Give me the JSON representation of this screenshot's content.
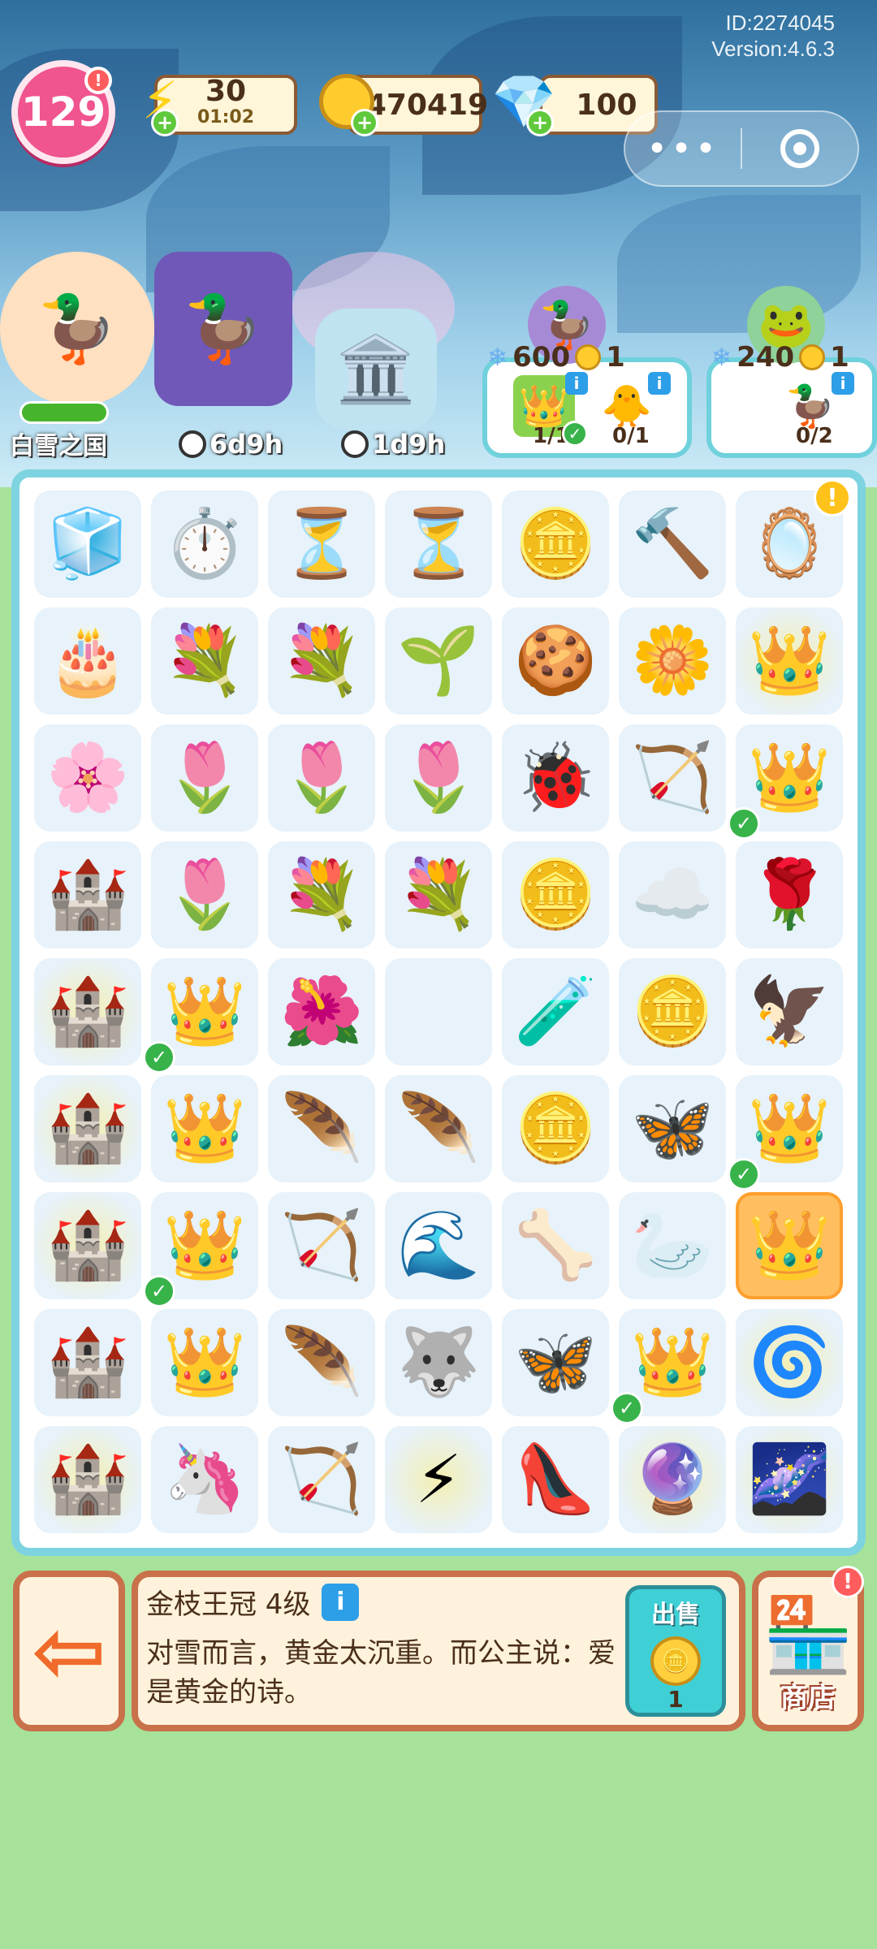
{
  "header": {
    "id": "ID:2274045",
    "version": "Version:4.6.3",
    "level": "129",
    "level_alert": "!",
    "energy": {
      "value": "30",
      "timer": "01:02",
      "icon": "lightning-icon"
    },
    "coins": {
      "value": "470419",
      "icon": "coin-icon"
    },
    "gems": {
      "value": "100",
      "icon": "gem-icon"
    },
    "plus": "+",
    "more_menu": "•••"
  },
  "events": {
    "kingdom_label": "白雪之国",
    "timer_1": "6d9h",
    "timer_2": "1d9h"
  },
  "orders": [
    {
      "reward_points": "600",
      "reward_coins": "1",
      "requirements": [
        {
          "count": "1/1",
          "done": true,
          "icon": "gold-crown-icon"
        },
        {
          "count": "0/1",
          "done": false,
          "icon": "duck-fairy-icon"
        }
      ]
    },
    {
      "reward_points": "240",
      "reward_coins": "1",
      "requirements": [
        {
          "count": "0/2",
          "done": false,
          "icon": "winged-duck-icon"
        }
      ]
    }
  ],
  "board": {
    "rows": [
      [
        "🧊",
        "⏱️",
        "⏳",
        "⏳",
        "🪙",
        "🔨",
        "🪞"
      ],
      [
        "🎂",
        "💐",
        "💐",
        "🌱",
        "🍪",
        "🌼",
        "👑"
      ],
      [
        "🌸",
        "🌷",
        "🌷",
        "🌷",
        "🐞",
        "🏹",
        "👑"
      ],
      [
        "🏰",
        "🌷",
        "💐",
        "💐",
        "🪙",
        "☁️",
        "🌹"
      ],
      [
        "🏰",
        "👑",
        "🌺",
        "",
        "🧪",
        "🪙",
        "🦅"
      ],
      [
        "🏰",
        "👑",
        "🪶",
        "🪶",
        "🪙",
        "🦋",
        "👑"
      ],
      [
        "🏰",
        "👑",
        "🏹",
        "🌊",
        "🦴",
        "🦢",
        "👑"
      ],
      [
        "🏰",
        "👑",
        "🪶",
        "🐺",
        "🦋",
        "👑",
        "🌀"
      ],
      [
        "🏰",
        "🦄",
        "🏹",
        "⚡",
        "👠",
        "🔮",
        "🌌"
      ]
    ],
    "checked": [
      "2-6",
      "4-1",
      "5-6",
      "6-1",
      "7-5"
    ],
    "glowing": [
      "1-6",
      "4-0",
      "5-0",
      "6-0",
      "8-0",
      "8-3",
      "8-5",
      "8-6",
      "7-6"
    ],
    "selected": "6-6"
  },
  "detail": {
    "title": "金枝王冠 4级",
    "info": "i",
    "description": "对雪而言，黄金太沉重。而公主说：爱是黄金的诗。",
    "sell_label": "出售",
    "sell_price": "1",
    "shop_label": "商店",
    "shop_alert": "!"
  },
  "colors": {
    "board_border": "#7ed3e0",
    "panel_border": "#c8714a",
    "sell_button": "#3fd0d6",
    "background_green": "#a6e29a"
  }
}
